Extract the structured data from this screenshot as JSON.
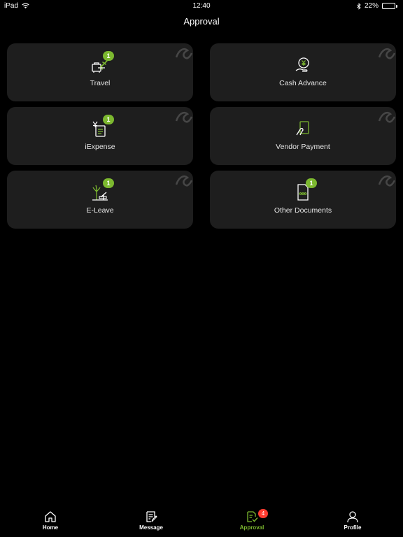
{
  "status_bar": {
    "device": "iPad",
    "time": "12:40",
    "battery": "22%",
    "battery_level": 0.22,
    "battery_color": "#4cd964",
    "icons": [
      "wifi-icon",
      "bluetooth-icon",
      "battery-icon"
    ]
  },
  "header": {
    "title": "Approval"
  },
  "colors": {
    "accent": "#7cb82f",
    "card_bg": "#1e1e1e",
    "background": "#000000",
    "alert_badge": "#ff3b30"
  },
  "cards": [
    {
      "label": "Travel",
      "badge": "1",
      "icon": "travel-icon"
    },
    {
      "label": "Cash Advance",
      "badge": "",
      "icon": "cash-advance-icon"
    },
    {
      "label": "iExpense",
      "badge": "1",
      "icon": "expense-icon"
    },
    {
      "label": "Vendor Payment",
      "badge": "",
      "icon": "vendor-payment-icon"
    },
    {
      "label": "E-Leave",
      "badge": "1",
      "icon": "leave-icon"
    },
    {
      "label": "Other Documents",
      "badge": "1",
      "icon": "document-icon"
    }
  ],
  "tabs": [
    {
      "label": "Home",
      "icon": "home-icon",
      "active": false
    },
    {
      "label": "Message",
      "icon": "message-icon",
      "active": false
    },
    {
      "label": "Approval",
      "icon": "approval-icon",
      "active": true,
      "badge": "4"
    },
    {
      "label": "Profile",
      "icon": "profile-icon",
      "active": false
    }
  ]
}
